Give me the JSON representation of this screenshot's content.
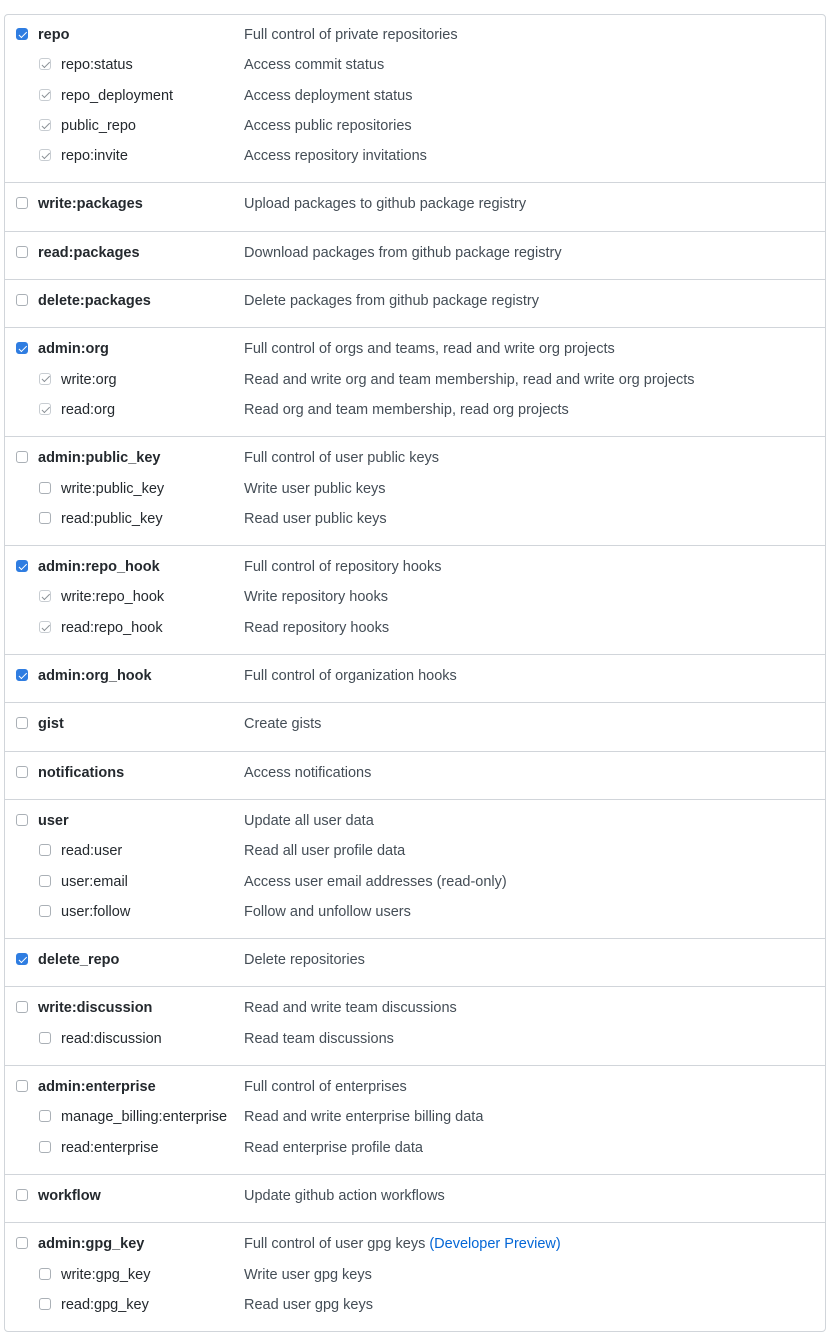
{
  "groups": [
    {
      "scopes": [
        {
          "name": "repo",
          "description": "Full control of private repositories",
          "state": "checked",
          "level": "parent"
        },
        {
          "name": "repo:status",
          "description": "Access commit status",
          "state": "implied",
          "level": "child"
        },
        {
          "name": "repo_deployment",
          "description": "Access deployment status",
          "state": "implied",
          "level": "child"
        },
        {
          "name": "public_repo",
          "description": "Access public repositories",
          "state": "implied",
          "level": "child"
        },
        {
          "name": "repo:invite",
          "description": "Access repository invitations",
          "state": "implied",
          "level": "child"
        }
      ]
    },
    {
      "scopes": [
        {
          "name": "write:packages",
          "description": "Upload packages to github package registry",
          "state": "unchecked",
          "level": "parent"
        }
      ]
    },
    {
      "scopes": [
        {
          "name": "read:packages",
          "description": "Download packages from github package registry",
          "state": "unchecked",
          "level": "parent"
        }
      ]
    },
    {
      "scopes": [
        {
          "name": "delete:packages",
          "description": "Delete packages from github package registry",
          "state": "unchecked",
          "level": "parent"
        }
      ]
    },
    {
      "scopes": [
        {
          "name": "admin:org",
          "description": "Full control of orgs and teams, read and write org projects",
          "state": "checked",
          "level": "parent"
        },
        {
          "name": "write:org",
          "description": "Read and write org and team membership, read and write org projects",
          "state": "implied",
          "level": "child"
        },
        {
          "name": "read:org",
          "description": "Read org and team membership, read org projects",
          "state": "implied",
          "level": "child"
        }
      ]
    },
    {
      "scopes": [
        {
          "name": "admin:public_key",
          "description": "Full control of user public keys",
          "state": "unchecked",
          "level": "parent"
        },
        {
          "name": "write:public_key",
          "description": "Write user public keys",
          "state": "unchecked",
          "level": "child"
        },
        {
          "name": "read:public_key",
          "description": "Read user public keys",
          "state": "unchecked",
          "level": "child"
        }
      ]
    },
    {
      "scopes": [
        {
          "name": "admin:repo_hook",
          "description": "Full control of repository hooks",
          "state": "checked",
          "level": "parent"
        },
        {
          "name": "write:repo_hook",
          "description": "Write repository hooks",
          "state": "implied",
          "level": "child"
        },
        {
          "name": "read:repo_hook",
          "description": "Read repository hooks",
          "state": "implied",
          "level": "child"
        }
      ]
    },
    {
      "scopes": [
        {
          "name": "admin:org_hook",
          "description": "Full control of organization hooks",
          "state": "checked",
          "level": "parent"
        }
      ]
    },
    {
      "scopes": [
        {
          "name": "gist",
          "description": "Create gists",
          "state": "unchecked",
          "level": "parent"
        }
      ]
    },
    {
      "scopes": [
        {
          "name": "notifications",
          "description": "Access notifications",
          "state": "unchecked",
          "level": "parent"
        }
      ]
    },
    {
      "scopes": [
        {
          "name": "user",
          "description": "Update all user data",
          "state": "unchecked",
          "level": "parent"
        },
        {
          "name": "read:user",
          "description": "Read all user profile data",
          "state": "unchecked",
          "level": "child"
        },
        {
          "name": "user:email",
          "description": "Access user email addresses (read-only)",
          "state": "unchecked",
          "level": "child"
        },
        {
          "name": "user:follow",
          "description": "Follow and unfollow users",
          "state": "unchecked",
          "level": "child"
        }
      ]
    },
    {
      "scopes": [
        {
          "name": "delete_repo",
          "description": "Delete repositories",
          "state": "checked",
          "level": "parent"
        }
      ]
    },
    {
      "scopes": [
        {
          "name": "write:discussion",
          "description": "Read and write team discussions",
          "state": "unchecked",
          "level": "parent"
        },
        {
          "name": "read:discussion",
          "description": "Read team discussions",
          "state": "unchecked",
          "level": "child"
        }
      ]
    },
    {
      "scopes": [
        {
          "name": "admin:enterprise",
          "description": "Full control of enterprises",
          "state": "unchecked",
          "level": "parent"
        },
        {
          "name": "manage_billing:enterprise",
          "description": "Read and write enterprise billing data",
          "state": "unchecked",
          "level": "child"
        },
        {
          "name": "read:enterprise",
          "description": "Read enterprise profile data",
          "state": "unchecked",
          "level": "child"
        }
      ]
    },
    {
      "scopes": [
        {
          "name": "workflow",
          "description": "Update github action workflows",
          "state": "unchecked",
          "level": "parent"
        }
      ]
    },
    {
      "scopes": [
        {
          "name": "admin:gpg_key",
          "description": "Full control of user gpg keys",
          "preview": "(Developer Preview)",
          "state": "unchecked",
          "level": "parent"
        },
        {
          "name": "write:gpg_key",
          "description": "Write user gpg keys",
          "state": "unchecked",
          "level": "child"
        },
        {
          "name": "read:gpg_key",
          "description": "Read user gpg keys",
          "state": "unchecked",
          "level": "child"
        }
      ]
    }
  ],
  "colors": {
    "checked": "#2f7de1",
    "link": "#0366d6",
    "border": "#d1d5da"
  }
}
